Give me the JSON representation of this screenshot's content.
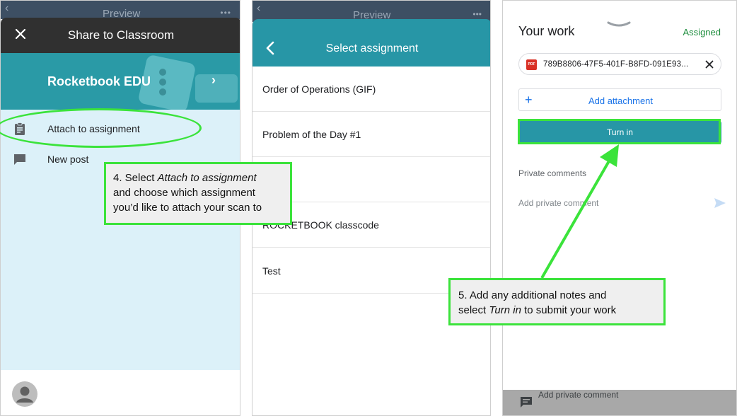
{
  "panel1": {
    "ghost_title": "Preview",
    "ghost_dots": "•••",
    "header_title": "Share to Classroom",
    "class_name": "Rocketbook EDU",
    "items": [
      {
        "label": "Attach to assignment",
        "icon": "clipboard-icon"
      },
      {
        "label": "New post",
        "icon": "comment-icon"
      }
    ],
    "colors": {
      "header": "#303030",
      "banner": "#2a9aa6",
      "list_bg": "#dcf1f9"
    }
  },
  "panel2": {
    "ghost_title": "Preview",
    "ghost_dots": "•••",
    "header_title": "Select assignment",
    "assignments": [
      "Order of Operations (GIF)",
      "Problem of the Day #1",
      "",
      "ROCKETBOOK classcode",
      "Test"
    ],
    "colors": {
      "header": "#2796a6"
    }
  },
  "panel3": {
    "title": "Your work",
    "status": "Assigned",
    "attachment": {
      "filename": "789B8806-47F5-401F-B8FD-091E93...",
      "type_icon": "pdf-icon"
    },
    "add_attachment_label": "Add attachment",
    "turn_in_label": "Turn in",
    "private_comments_label": "Private comments",
    "add_private_comment_placeholder": "Add private comment",
    "bottom_bar_label": "Add private comment",
    "colors": {
      "accent": "#2796a6",
      "status": "#1e8e3e",
      "link": "#1a73e8"
    }
  },
  "callouts": {
    "step4": {
      "number": "4. Select ",
      "em": "Attach to assignment",
      "line2": "and choose which assignment",
      "line3": "you’d like to attach your scan to"
    },
    "step5": {
      "line1": "5. Add any additional notes and",
      "pre": "select ",
      "em": "Turn in",
      "post": " to submit your work"
    }
  },
  "highlight_color": "#3be33b"
}
